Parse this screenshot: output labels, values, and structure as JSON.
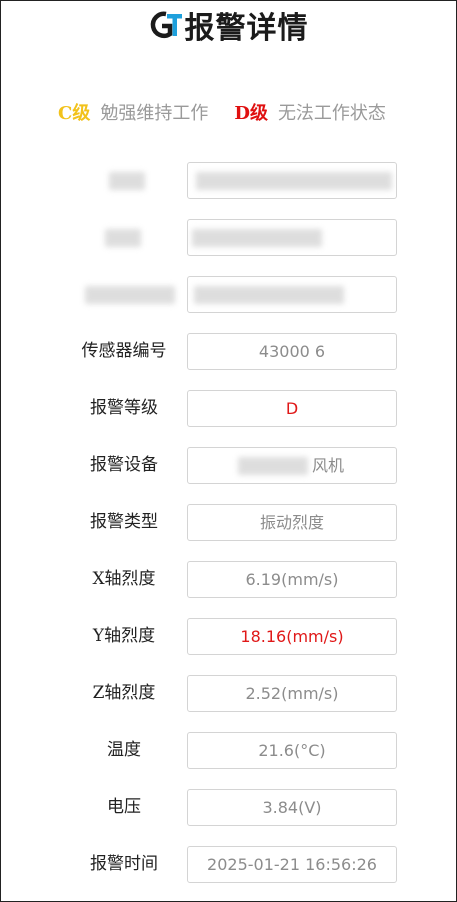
{
  "header": {
    "title": "报警详情"
  },
  "legend": {
    "c_code": "C级",
    "c_desc": "勉强维持工作",
    "d_code": "D级",
    "d_desc": "无法工作状态"
  },
  "fields": {
    "sensor_id": {
      "label": "传感器编号",
      "value": "43000 6"
    },
    "alarm_level": {
      "label": "报警等级",
      "value": "D"
    },
    "alarm_device": {
      "label": "报警设备",
      "value": "风机"
    },
    "alarm_type": {
      "label": "报警类型",
      "value": "振动烈度"
    },
    "x_axis": {
      "label": "X轴烈度",
      "value": "6.19(mm/s)"
    },
    "y_axis": {
      "label": "Y轴烈度",
      "value": "18.16(mm/s)"
    },
    "z_axis": {
      "label": "Z轴烈度",
      "value": "2.52(mm/s)"
    },
    "temperature": {
      "label": "温度",
      "value": "21.6(°C)"
    },
    "voltage": {
      "label": "电压",
      "value": "3.84(V)"
    },
    "alarm_time": {
      "label": "报警时间",
      "value": "2025-01-21 16:56:26"
    }
  },
  "colors": {
    "level_c": "#f2c21b",
    "level_d": "#e01010",
    "logo_blue": "#1ea0dc",
    "logo_dark": "#1b1b1b"
  },
  "icons": {
    "logo": "gt-logo-icon"
  }
}
